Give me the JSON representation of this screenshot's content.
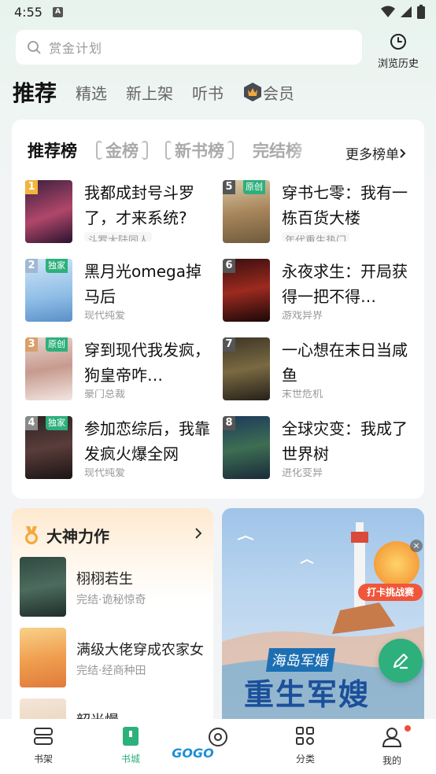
{
  "status": {
    "time": "4:55",
    "notif_icon": "A"
  },
  "search": {
    "placeholder": "赏金计划"
  },
  "history": {
    "label": "浏览历史"
  },
  "top_tabs": [
    {
      "label": "推荐",
      "active": true
    },
    {
      "label": "精选"
    },
    {
      "label": "新上架"
    },
    {
      "label": "听书"
    },
    {
      "label": "会员"
    }
  ],
  "rank_tabs": [
    {
      "label": "推荐榜",
      "active": true
    },
    {
      "label": "金榜"
    },
    {
      "label": "新书榜"
    },
    {
      "label": "完结榜"
    }
  ],
  "more_rank": "更多榜单",
  "rank_books": [
    {
      "rank": "1",
      "title": "我都成封号斗罗了，才来系统?",
      "sub": "斗罗大陆同人",
      "tag": ""
    },
    {
      "rank": "2",
      "title": "黑月光omega掉马后",
      "sub": "现代纯爱",
      "tag": "独家"
    },
    {
      "rank": "3",
      "title": "穿到现代我发疯，狗皇帝咋…",
      "sub": "豪门总裁",
      "tag": "原创"
    },
    {
      "rank": "4",
      "title": "参加恋综后，我靠发疯火爆全网",
      "sub": "现代纯爱",
      "tag": "独家"
    },
    {
      "rank": "5",
      "title": "穿书七零：我有一栋百货大楼",
      "sub": "年代重生热门",
      "tag": "原创"
    },
    {
      "rank": "6",
      "title": "永夜求生：开局获得一把不得…",
      "sub": "游戏异界",
      "tag": ""
    },
    {
      "rank": "7",
      "title": "一心想在末日当咸鱼",
      "sub": "末世危机",
      "tag": ""
    },
    {
      "rank": "8",
      "title": "全球灾变：我成了世界树",
      "sub": "进化变异",
      "tag": ""
    }
  ],
  "god_works": {
    "title": "大神力作",
    "books": [
      {
        "title": "栩栩若生",
        "sub": "完结·诡秘惊奇"
      },
      {
        "title": "满级大佬穿成农家女",
        "sub": "完结·经商种田"
      },
      {
        "title": "韶光慢",
        "sub": ""
      }
    ]
  },
  "banner": {
    "badge": "打卡挑战赛",
    "subtitle": "海岛军婚",
    "headline": "重生军嫂"
  },
  "bottom_nav": [
    {
      "label": "书架"
    },
    {
      "label": "书城",
      "active": true
    },
    {
      "label": "GOGO"
    },
    {
      "label": "分类"
    },
    {
      "label": "我的"
    }
  ],
  "colors": {
    "accent": "#2db07b",
    "gold": "#f2a93b",
    "badge_red": "#f04c3c"
  }
}
